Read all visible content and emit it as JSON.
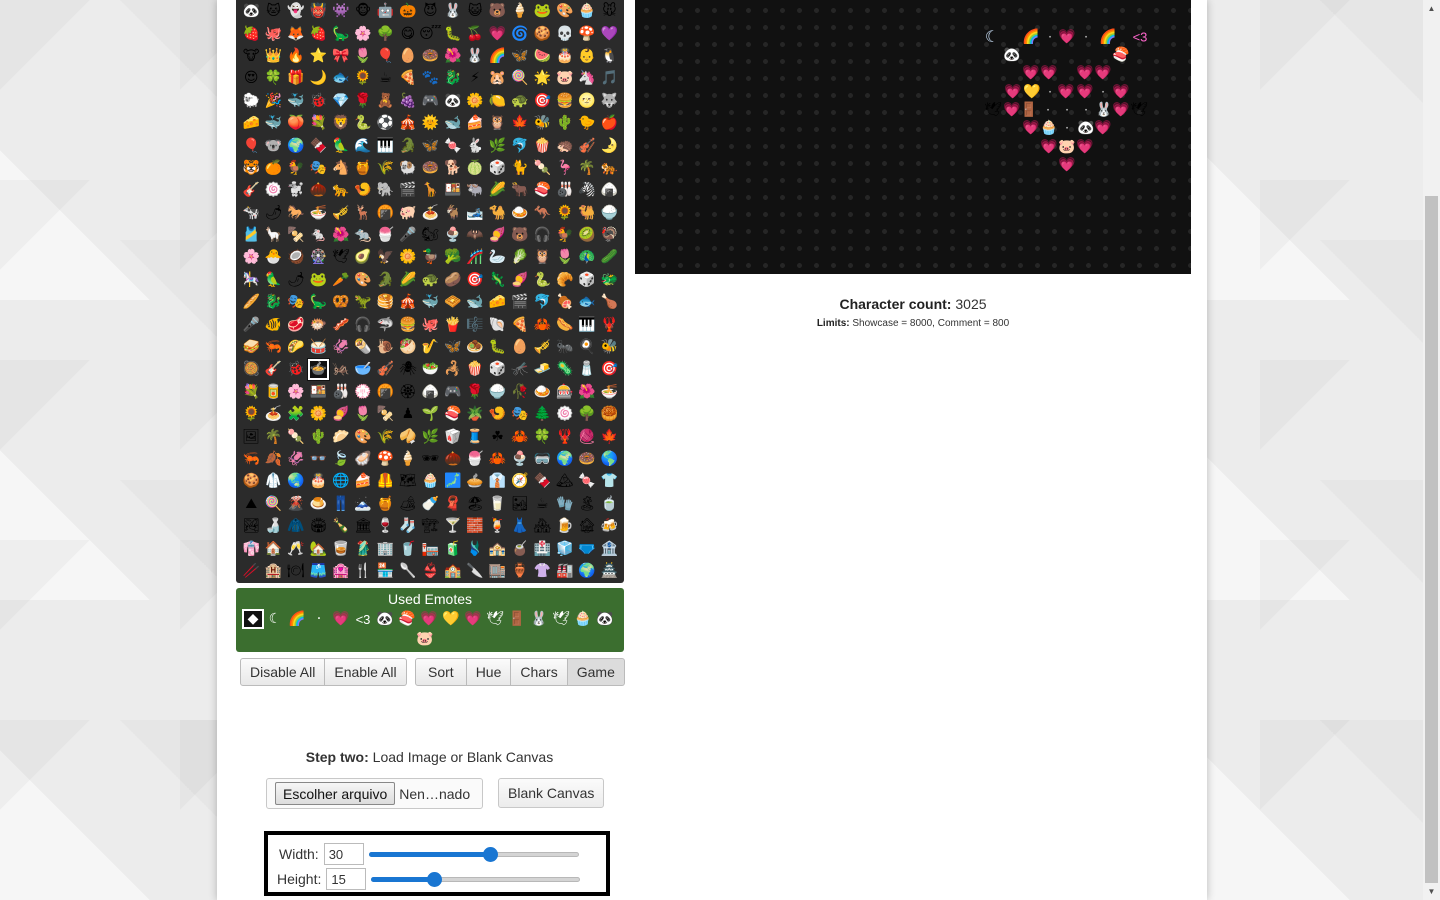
{
  "palette": {
    "emotes": [
      "🐼",
      "🐱",
      "👻",
      "👹",
      "👾",
      "🐵",
      "🤖",
      "🎃",
      "😈",
      "🐰",
      "😺",
      "🐻",
      "🍦",
      "🐸",
      "🎨",
      "🧁",
      "🐭",
      "🍓",
      "🐙",
      "🦊",
      "🍓",
      "🦕",
      "🌸",
      "🌳",
      "😋",
      "😴",
      "🐛",
      "🍒",
      "💗",
      "🌀",
      "🍪",
      "💀",
      "🍄",
      "💜",
      "🐮",
      "👑",
      "🔥",
      "⭐",
      "🎀",
      "🌷",
      "🎈",
      "🥚",
      "🍩",
      "🌺",
      "🐰",
      "🌈",
      "🦋",
      "🍉",
      "🎂",
      "👶",
      "🐧",
      "😍",
      "🍀",
      "🎁",
      "🌙",
      "🐟",
      "🌻",
      "☕",
      "🍕",
      "🐾",
      "🐉",
      "⚡",
      "🐹",
      "🍭",
      "🌟",
      "🐷",
      "🦄",
      "🎵",
      "🐑",
      "🎉",
      "🐳",
      "🐞",
      "💎",
      "🌹",
      "🧸",
      "🍇",
      "🎮",
      "🐼",
      "🌼",
      "🍋",
      "🐢",
      "🎯",
      "🍔",
      "🌝",
      "🐺",
      "🧀",
      "🐳",
      "🍑",
      "💐",
      "🦁",
      "🐍",
      "⚽",
      "🎪",
      "🌞",
      "🐋",
      "🍰",
      "🦉",
      "🍁",
      "🐝",
      "🌵",
      "🐤",
      "🍎",
      "🎈",
      "🐨",
      "🌍",
      "🍫",
      "🦜",
      "🌊",
      "🎹",
      "🐊",
      "🦋",
      "🍬",
      "🐇",
      "🌿",
      "🐬",
      "🍿",
      "🦔",
      "🎻",
      "🌛",
      "🐯",
      "🍊",
      "🐓",
      "🎭",
      "🐴",
      "🍯",
      "🌾",
      "🐏",
      "🍩",
      "🐕",
      "🍈",
      "🎲",
      "🐈",
      "🍡",
      "🦩",
      "🌴",
      "🐅",
      "🎸",
      "🍥",
      "🐩",
      "🌰",
      "🐆",
      "🍤",
      "🐘",
      "🎬",
      "🦒",
      "🍱",
      "🐃",
      "🌽",
      "🐂",
      "🍣",
      "🎳",
      "🦓",
      "🍙",
      "🐄",
      "🌶",
      "🐎",
      "🍜",
      "🎺",
      "🦌",
      "🍘",
      "🐖",
      "🍝",
      "🐐",
      "🎿",
      "🐪",
      "🍛",
      "🦘",
      "🌻",
      "🐫",
      "🍚",
      "🎽",
      "🦙",
      "🍢",
      "🐁",
      "🌺",
      "🐀",
      "🍧",
      "🎤",
      "🐿",
      "🍨",
      "🦇",
      "🍠",
      "🐻",
      "🎧",
      "🐓",
      "🥝",
      "🦃",
      "🌸",
      "🐣",
      "🥥",
      "🎡",
      "🕊",
      "🥑",
      "🦅",
      "🌼",
      "🦆",
      "🥦",
      "🎢",
      "🦢",
      "🥬",
      "🦉",
      "🌷",
      "🦚",
      "🥒",
      "🎠",
      "🦜",
      "🌶",
      "🐸",
      "🥕",
      "🎨",
      "🐊",
      "🌽",
      "🐢",
      "🥔",
      "🎯",
      "🦎",
      "🍠",
      "🐍",
      "🥐",
      "🎲",
      "🐲",
      "🥖",
      "🐉",
      "🎭",
      "🦕",
      "🥨",
      "🦖",
      "🥞",
      "🎪",
      "🐳",
      "🧇",
      "🐋",
      "🧀",
      "🎬",
      "🐬",
      "🍖",
      "🐟",
      "🍗",
      "🎤",
      "🐠",
      "🥩",
      "🐡",
      "🥓",
      "🎧",
      "🦈",
      "🍔",
      "🐙",
      "🍟",
      "🎼",
      "🐚",
      "🍕",
      "🦀",
      "🌭",
      "🎹",
      "🦞",
      "🥪",
      "🦐",
      "🌮",
      "🥁",
      "🦑",
      "🌯",
      "🐌",
      "🥙",
      "🎷",
      "🦋",
      "🧆",
      "🐛",
      "🥚",
      "🎺",
      "🐜",
      "🍳",
      "🐝",
      "🥘",
      "🎸",
      "🐞",
      "🍲",
      "🦗",
      "🥣",
      "🎻",
      "🕷",
      "🥗",
      "🦂",
      "🍿",
      "🎲",
      "🦟",
      "🧈",
      "🦠",
      "🧂",
      "🎯",
      "💐",
      "🥫",
      "🌸",
      "🍱",
      "🎳",
      "💮",
      "🍘",
      "🏵",
      "🍙",
      "🎮",
      "🌹",
      "🍚",
      "🥀",
      "🍛",
      "🎰",
      "🌺",
      "🍜",
      "🌻",
      "🍝",
      "🧩",
      "🌼",
      "🍠",
      "🌷",
      "🍢",
      "♟",
      "🌱",
      "🍣",
      "🪴",
      "🍤",
      "🎭",
      "🌲",
      "🍥",
      "🌳",
      "🥮",
      "🖼",
      "🌴",
      "🍡",
      "🌵",
      "🥟",
      "🎨",
      "🌾",
      "🥠",
      "🌿",
      "🥡",
      "🧵",
      "☘",
      "🦀",
      "🍀",
      "🦞",
      "🧶",
      "🍁",
      "🦐",
      "🍂",
      "🦑",
      "👓",
      "🍃",
      "🦪",
      "🍄",
      "🍦",
      "🕶",
      "🌰",
      "🍧",
      "🦀",
      "🍨",
      "🥽",
      "🌍",
      "🍩",
      "🌎",
      "🍪",
      "🥼",
      "🌏",
      "🎂",
      "🌐",
      "🍰",
      "🦺",
      "🗺",
      "🧁",
      "🗾",
      "🥧",
      "👔",
      "🧭",
      "🍫",
      "🏔",
      "🍬",
      "👕",
      "⛰",
      "🍭",
      "🌋",
      "🍮",
      "👖",
      "🗻",
      "🍯",
      "🏕",
      "🍼",
      "🧣",
      "🏖",
      "🥛",
      "🏜",
      "☕",
      "🧤",
      "🏝",
      "🍵",
      "🏞",
      "🍶",
      "🧥",
      "🏟",
      "🍾",
      "🏛",
      "🍷",
      "🧦",
      "🏗",
      "🍸",
      "🧱",
      "🍹",
      "👗",
      "🏘",
      "🍺",
      "🏚",
      "🍻",
      "👘",
      "🏠",
      "🥂",
      "🏡",
      "🥃",
      "🥻",
      "🏢",
      "🥤",
      "🏣",
      "🧃",
      "🩱",
      "🏤",
      "🧉",
      "🏥",
      "🧊",
      "🩲",
      "🏦",
      "🥢",
      "🏨",
      "🍽",
      "🩳",
      "🏩",
      "🍴",
      "🏪",
      "🥄",
      "👙",
      "🏫",
      "🔪",
      "🏬",
      "🏺",
      "👚",
      "🏭",
      "🌍",
      "🏯",
      "🌎",
      "👛",
      "🏰",
      "🌏",
      "💒",
      "🌐",
      "👜",
      "🗼",
      "🗺",
      "🗽",
      "🗾",
      "👝",
      "⛪",
      "🧭",
      "🕌",
      "🏔",
      "🛍",
      "🛕",
      "⛰",
      "🕍",
      "🌋",
      "🎒",
      "⛩",
      "🗻",
      "🕋",
      "🏕",
      "👞",
      "⛲",
      "🏖",
      "⛺",
      "🏜",
      "👟",
      "🌁",
      "🏝",
      "🌃",
      "🏞",
      "🥾",
      "🏙"
    ],
    "selected_index": 275
  },
  "used_emotes": {
    "title": "Used Emotes",
    "items": [
      "◆",
      "☾",
      "🌈",
      "·",
      "💗",
      "<3",
      "🐼",
      "🍣",
      "💗",
      "💛",
      "💗",
      "🕊",
      "🚪",
      "🐰",
      "🕊",
      "🧁",
      "🐼",
      "🐷"
    ],
    "selected_index": 0
  },
  "toolbar": {
    "disable_all": "Disable All",
    "enable_all": "Enable All",
    "sort": "Sort",
    "hue": "Hue",
    "chars": "Chars",
    "game": "Game"
  },
  "step_two": {
    "label_bold": "Step two:",
    "label_rest": " Load Image or Blank Canvas",
    "choose_file": "Escolher arquivo",
    "file_name": "Nen…nado",
    "blank_canvas": "Blank Canvas"
  },
  "size": {
    "width_label": "Width:",
    "width_value": "30",
    "width_fraction": 0.58,
    "height_label": "Height:",
    "height_value": "15",
    "height_fraction": 0.3
  },
  "canvas": {
    "art": [
      [
        "☾",
        "🌈",
        "·",
        "💗",
        "·",
        "🌈",
        "<3"
      ],
      [
        "🐼",
        "🍣"
      ],
      [
        "💗",
        "💗",
        "💗",
        "💗"
      ],
      [
        "💗",
        "💛",
        "·",
        "💗",
        "💗",
        "·",
        "💗"
      ],
      [
        "🕊",
        "💗",
        "🚪",
        "·",
        "·",
        "·",
        "🐰",
        "💗",
        "🕊"
      ],
      [
        "💗",
        "🧁",
        "·",
        "🐼",
        "💗"
      ],
      [
        "💗",
        "🐷",
        "💗"
      ],
      [
        "💗"
      ]
    ]
  },
  "stats": {
    "char_count_label": "Character count:",
    "char_count_value": "3025",
    "limits_label": "Limits:",
    "limits_text": "Showcase = 8000, Comment = 800"
  }
}
